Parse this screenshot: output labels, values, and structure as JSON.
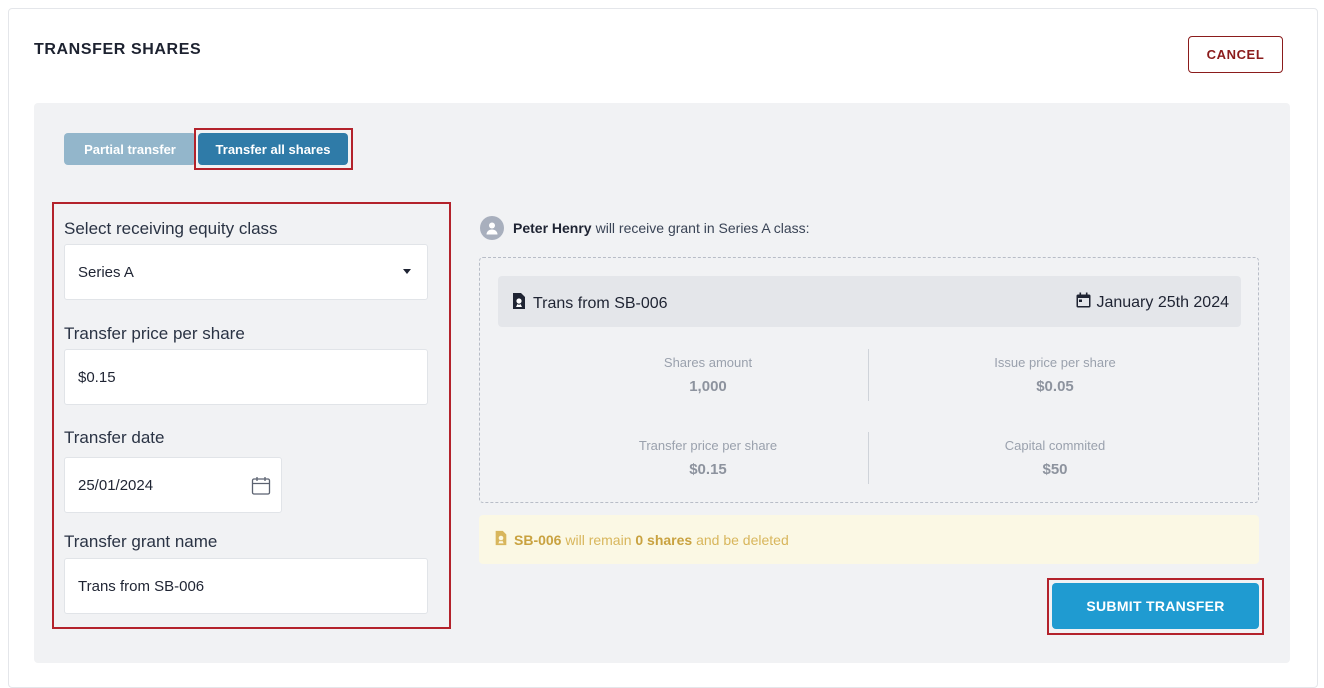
{
  "header": {
    "title": "TRANSFER SHARES",
    "cancel_label": "CANCEL"
  },
  "mode_toggle": {
    "partial_label": "Partial transfer",
    "all_label": "Transfer all shares",
    "selected": "all"
  },
  "form": {
    "equity_class_label": "Select receiving equity class",
    "equity_class_value": "Series A",
    "price_label": "Transfer price per share",
    "price_value": "$0.15",
    "date_label": "Transfer date",
    "date_value": "25/01/2024",
    "grant_name_label": "Transfer grant name",
    "grant_name_value": "Trans from SB-006"
  },
  "summary": {
    "receiver_name": "Peter Henry",
    "receiver_text": "will receive grant in Series A class:",
    "grant_name": "Trans from SB-006",
    "grant_date": "January 25th 2024",
    "stats": {
      "shares_amount_label": "Shares amount",
      "shares_amount_value": "1,000",
      "issue_price_label": "Issue price per share",
      "issue_price_value": "$0.05",
      "transfer_price_label": "Transfer price per share",
      "transfer_price_value": "$0.15",
      "capital_label": "Capital commited",
      "capital_value": "$50"
    }
  },
  "notice": {
    "source": "SB-006",
    "text1": "will remain",
    "amount": "0 shares",
    "text2": "and be deleted"
  },
  "actions": {
    "submit_label": "SUBMIT TRANSFER"
  },
  "colors": {
    "primary": "#1f9bd1",
    "toggle_active": "#2f7ba8",
    "toggle_inactive": "#93b6cb",
    "cancel": "#8b1c1c",
    "highlight": "#b3222b",
    "notice_bg": "#fbf8e4"
  }
}
